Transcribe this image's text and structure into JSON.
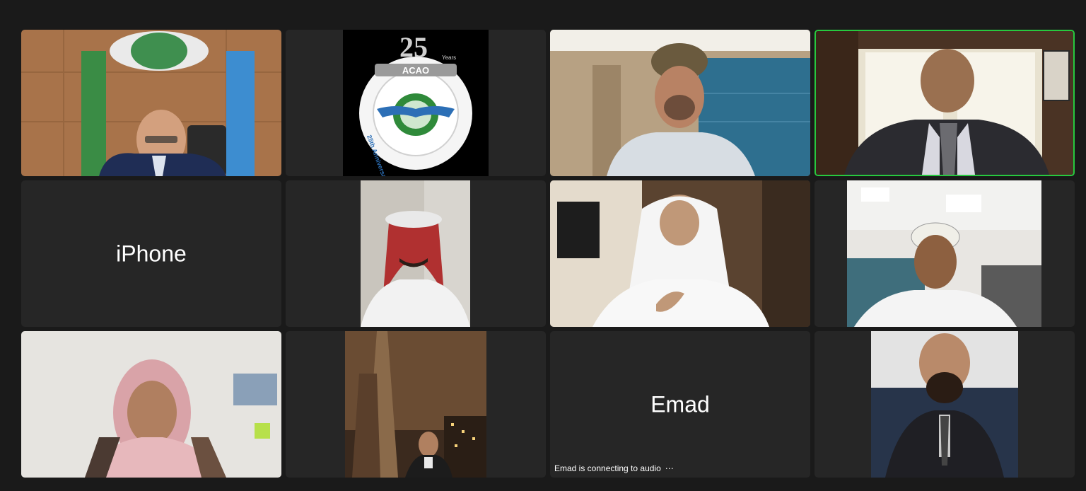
{
  "meeting": {
    "tiles": [
      {
        "kind": "video",
        "desc": "man-suit-flags"
      },
      {
        "kind": "logo",
        "logo": {
          "number": "25",
          "years": "Years",
          "acronym": "ACAO",
          "ring_text": "25th Anniversary"
        }
      },
      {
        "kind": "video",
        "desc": "man-turban-office"
      },
      {
        "kind": "video",
        "desc": "man-suit-window",
        "active": true
      },
      {
        "kind": "name",
        "name": "iPhone"
      },
      {
        "kind": "video",
        "desc": "man-ghutra-red"
      },
      {
        "kind": "video",
        "desc": "man-ghutra-white"
      },
      {
        "kind": "video",
        "desc": "man-turban-office-2"
      },
      {
        "kind": "video",
        "desc": "woman-hijab"
      },
      {
        "kind": "video",
        "desc": "city-night-tower"
      },
      {
        "kind": "name",
        "name": "Emad",
        "status": "Emad is connecting to audio",
        "status_icon": "ellipsis-icon"
      },
      {
        "kind": "video",
        "desc": "bald-man-beard"
      }
    ]
  },
  "colors": {
    "background": "#1a1a1a",
    "tile": "#262626",
    "active_border": "#27c93f"
  }
}
